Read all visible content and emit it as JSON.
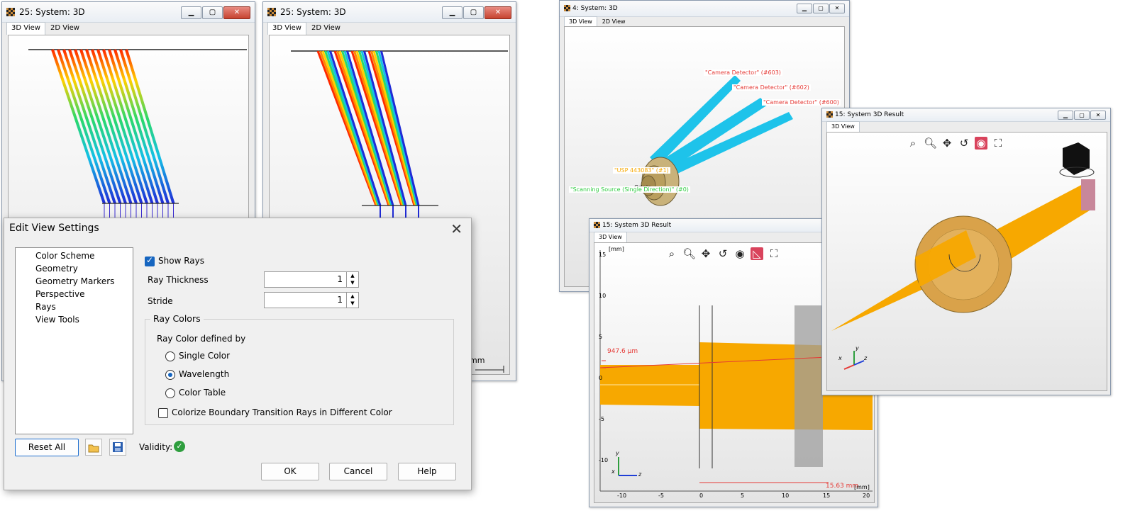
{
  "windows": {
    "left": {
      "title": "25: System: 3D",
      "tabs": [
        "3D View",
        "2D View"
      ]
    },
    "middle": {
      "title": "25: System: 3D",
      "tabs": [
        "3D View",
        "2D View"
      ],
      "unit_fragment": "mm"
    },
    "right_top": {
      "title": "4: System: 3D",
      "tabs": [
        "3D View",
        "2D View"
      ],
      "labels": {
        "det603": "\"Camera Detector\" (#603)",
        "det602": "\"Camera Detector\" (#602)",
        "det600": "\"Camera Detector\" (#600)",
        "usp": "\"USP 443083\" (#1)",
        "origin": "Origin",
        "source": "\"Scanning Source (Single Direction)\" (#0)"
      }
    },
    "result_front": {
      "title": "15: System 3D Result",
      "tabs": [
        "3D View"
      ],
      "axis_unit": "[mm]",
      "y_ticks": [
        "15",
        "10",
        "5",
        "0",
        "-5",
        "-10"
      ],
      "x_ticks": [
        "-10",
        "-5",
        "0",
        "5",
        "10",
        "15",
        "20"
      ],
      "dim1": "947.6 µm",
      "dim2": "15.63 mm",
      "axes": {
        "y": "y",
        "x": "x",
        "z": "z"
      }
    },
    "result_back": {
      "title": "15: System 3D Result",
      "tabs": [
        "3D View"
      ],
      "axes": {
        "y": "y",
        "x": "x",
        "z": "z"
      }
    }
  },
  "dialog": {
    "title": "Edit View Settings",
    "nav": [
      "Color Scheme",
      "Geometry",
      "Geometry Markers",
      "Perspective",
      "Rays",
      "View Tools"
    ],
    "show_rays": {
      "label": "Show Rays",
      "checked": true
    },
    "ray_thickness": {
      "label": "Ray Thickness",
      "value": "1"
    },
    "stride": {
      "label": "Stride",
      "value": "1"
    },
    "ray_colors": {
      "group": "Ray Colors",
      "defined_by": "Ray Color defined by",
      "options": [
        "Single Color",
        "Wavelength",
        "Color Table"
      ],
      "selected": "Wavelength"
    },
    "colorize": {
      "label": "Colorize Boundary Transition Rays in Different Color",
      "checked": false
    },
    "reset": "Reset All",
    "validity": "Validity:",
    "ok": "OK",
    "cancel": "Cancel",
    "help": "Help"
  },
  "colors": {
    "ray_orange": "#f7a800",
    "ray_cyan": "#1ec3ea",
    "accent": "#1565c0",
    "highlight": "#d9435c"
  }
}
